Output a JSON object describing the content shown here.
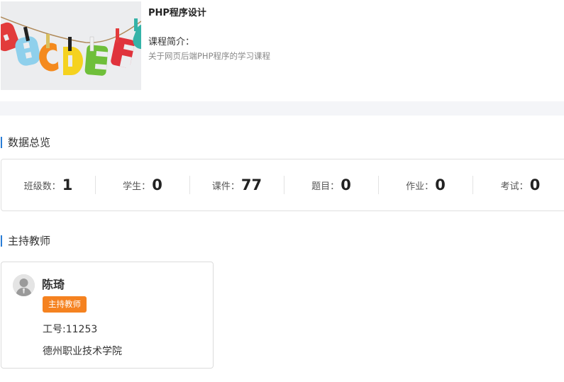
{
  "course": {
    "title": "PHP程序设计",
    "intro_label": "课程简介：",
    "intro_text": "关于网页后端PHP程序的学习课程",
    "cover_letters": [
      "A",
      "B",
      "C",
      "D",
      "E",
      "F",
      "G"
    ]
  },
  "overview": {
    "section_title": "数据总览",
    "stats": [
      {
        "label": "班级数：",
        "value": "1"
      },
      {
        "label": "学生：",
        "value": "0"
      },
      {
        "label": "课件：",
        "value": "77"
      },
      {
        "label": "题目：",
        "value": "0"
      },
      {
        "label": "作业：",
        "value": "0"
      },
      {
        "label": "考试：",
        "value": "0"
      }
    ]
  },
  "teachers": {
    "section_title": "主持教师",
    "card": {
      "name": "陈琦",
      "role": "主持教师",
      "id_text": "工号:11253",
      "org": "德州职业技术学院"
    }
  },
  "colors": {
    "accent": "#2a7dd6",
    "badge": "#f58220"
  }
}
